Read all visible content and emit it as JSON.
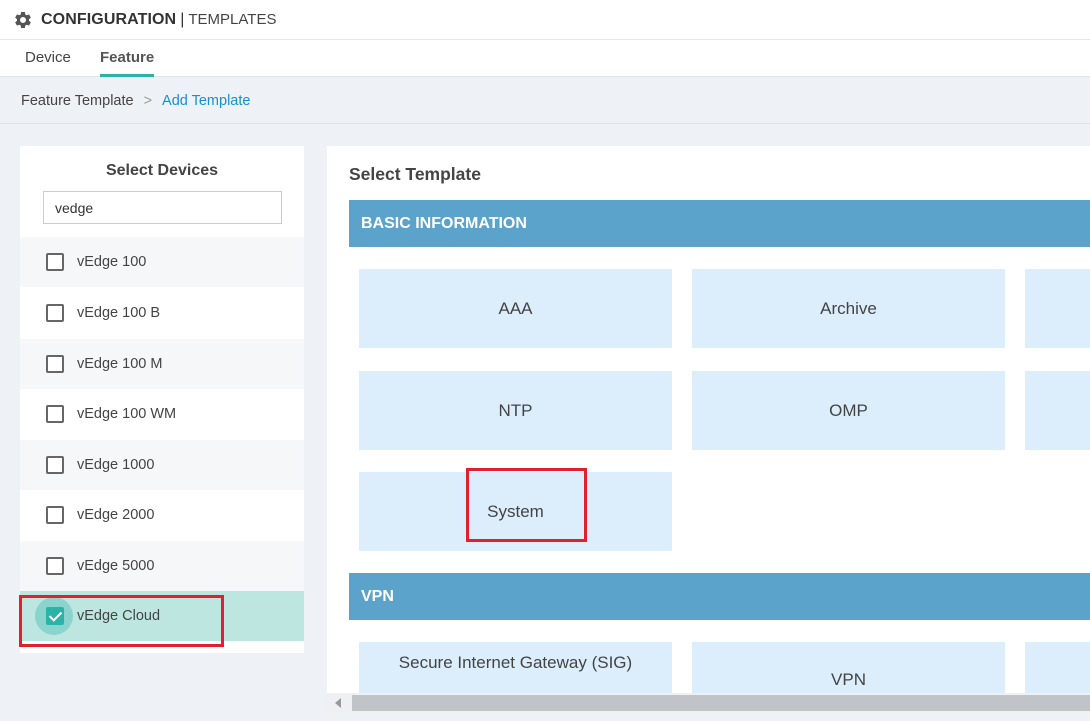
{
  "header": {
    "title_strong": "CONFIGURATION",
    "title_sep": "|",
    "title_sub": "TEMPLATES",
    "icon": "gear-icon"
  },
  "tabs": [
    {
      "label": "Device"
    },
    {
      "label": "Feature",
      "active": true
    }
  ],
  "breadcrumb": {
    "root": "Feature Template",
    "separator": ">",
    "current": "Add Template"
  },
  "devices_panel": {
    "title": "Select Devices",
    "search_value": "vedge",
    "items": [
      {
        "label": "vEdge 100",
        "checked": false
      },
      {
        "label": "vEdge 100 B",
        "checked": false
      },
      {
        "label": "vEdge 100 M",
        "checked": false
      },
      {
        "label": "vEdge 100 WM",
        "checked": false
      },
      {
        "label": "vEdge 1000",
        "checked": false
      },
      {
        "label": "vEdge 2000",
        "checked": false
      },
      {
        "label": "vEdge 5000",
        "checked": false
      },
      {
        "label": "vEdge Cloud",
        "checked": true
      }
    ]
  },
  "templates_panel": {
    "title": "Select Template",
    "sections": [
      {
        "name": "BASIC INFORMATION",
        "tiles": [
          "AAA",
          "Archive",
          "",
          "NTP",
          "OMP",
          "",
          "System"
        ]
      },
      {
        "name": "VPN",
        "tiles": [
          "Secure Internet Gateway (SIG)",
          "VPN",
          ""
        ]
      }
    ]
  },
  "colors": {
    "accent": "#2bb3a8",
    "section_bar": "#5ba3cb",
    "tile_bg": "#dcedfb",
    "link": "#1a8fd0",
    "highlight": "#e2202b"
  }
}
